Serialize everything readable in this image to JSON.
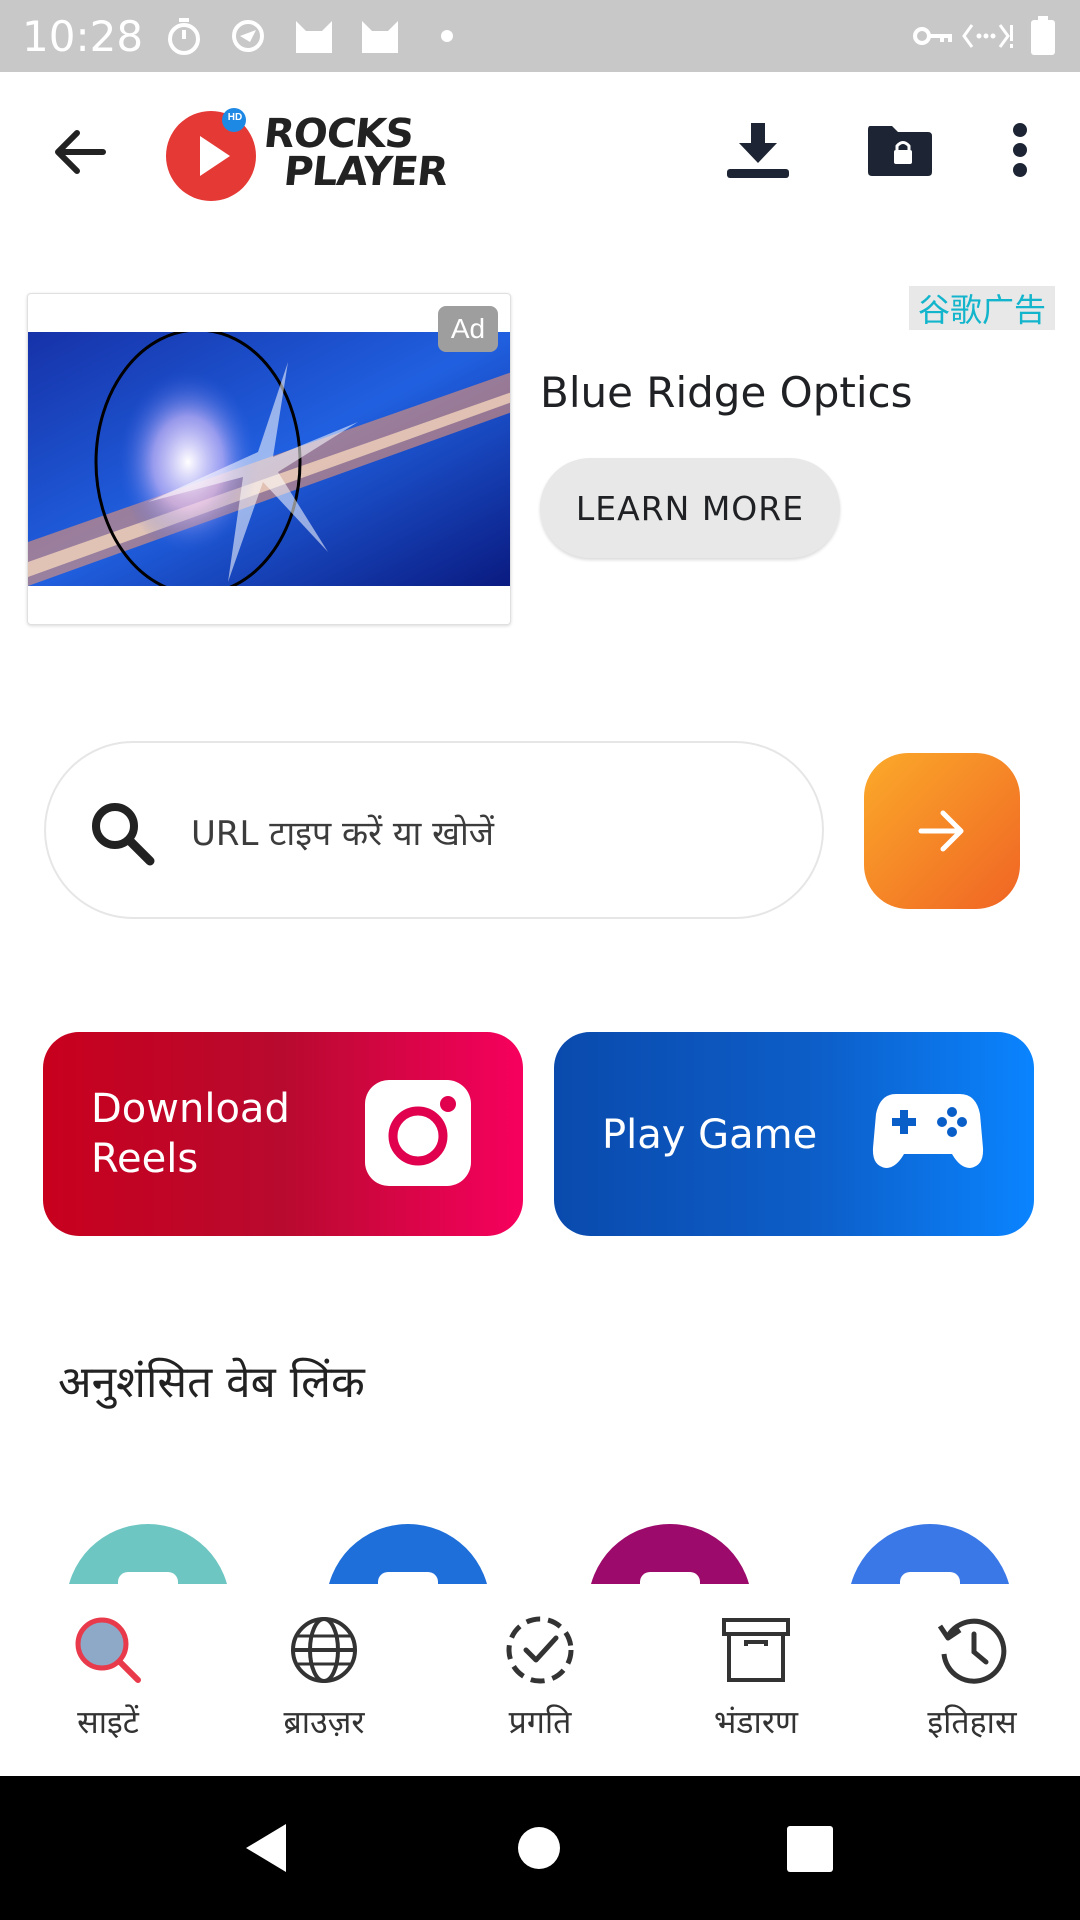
{
  "status_bar": {
    "time": "10:28",
    "left_icons": [
      "timer-icon",
      "sync-icon",
      "cat-icon",
      "cat-icon",
      "dot-icon"
    ],
    "right_icons": [
      "vpn-key-icon",
      "wifi-off-icon",
      "battery-full-icon"
    ]
  },
  "app_bar": {
    "logo_badge": "HD",
    "logo_text_line1": "ROCKS",
    "logo_text_line2": "PLAYER",
    "icons": [
      "back-arrow-icon",
      "download-icon",
      "locked-folder-icon",
      "more-vert-icon"
    ]
  },
  "ad": {
    "badge": "Ad",
    "network_label": "谷歌广告",
    "title": "Blue Ridge Optics",
    "cta": "LEARN MORE"
  },
  "search": {
    "placeholder": "URL टाइप करें या खोजें",
    "go_icon": "arrow-right-icon"
  },
  "actions": {
    "reels_line1": "Download",
    "reels_line2": "Reels",
    "game_label": "Play Game"
  },
  "recommended": {
    "title": "अनुशंसित वेब लिंक",
    "colors": [
      "#6ec6c3",
      "#1e6fd9",
      "#9c0a6b",
      "#3b78e7"
    ]
  },
  "bottom_nav": {
    "items": [
      {
        "label": "साइटें",
        "icon": "search-icon",
        "active": true
      },
      {
        "label": "ब्राउज़र",
        "icon": "globe-icon",
        "active": false
      },
      {
        "label": "प्रगति",
        "icon": "progress-check-icon",
        "active": false
      },
      {
        "label": "भंडारण",
        "icon": "archive-box-icon",
        "active": false
      },
      {
        "label": "इतिहास",
        "icon": "history-icon",
        "active": false
      }
    ]
  },
  "colors": {
    "accent_orange": "#f58a25",
    "reels_red": "#d10034",
    "game_blue": "#0a5ec8",
    "active_nav": "#e83a4a"
  }
}
